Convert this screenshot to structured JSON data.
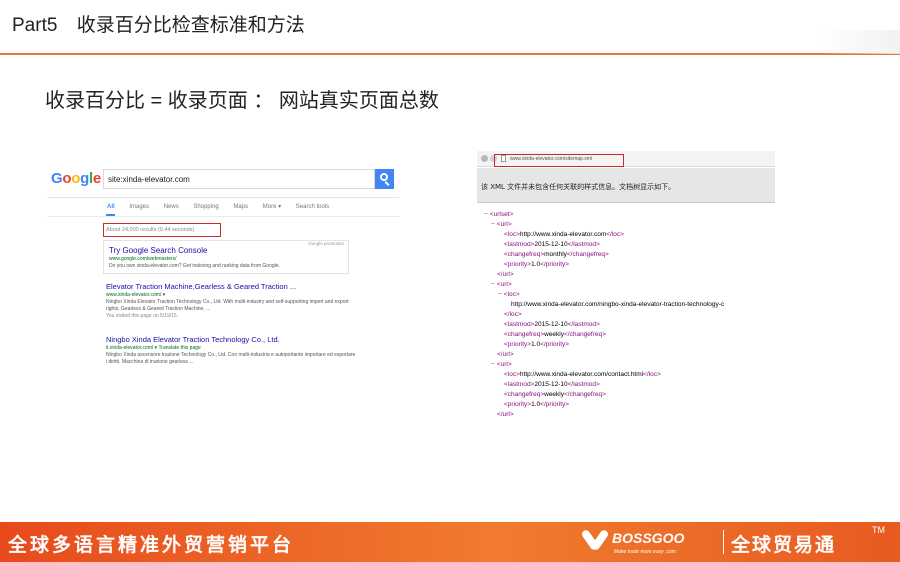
{
  "slide": {
    "part": "Part5",
    "title": "收录百分比检查标准和方法",
    "formula": "收录百分比 =  收录页面 ： 网站真实页面总数"
  },
  "accent_color": "#e8743b",
  "google": {
    "logo": [
      "G",
      "o",
      "o",
      "g",
      "l",
      "e"
    ],
    "search_value": "site:xinda-elevator.com",
    "tabs": [
      "All",
      "Images",
      "News",
      "Shopping",
      "Maps",
      "More ▾",
      "Search tools"
    ],
    "active_tab": "All",
    "stats": "About 24,000 results (0.44 seconds)",
    "promo": {
      "tag": "Google promotion",
      "title": "Try Google Search Console",
      "url": "www.google.com/webmasters/",
      "desc": "Do you own xinda-elevator.com? Get indexing and ranking data from Google."
    },
    "results": [
      {
        "title": "Elevator Traction Machine,Gearless & Geared Traction ...",
        "url": "www.xinda-elevator.com/ ▾",
        "desc": "Ningbo Xinda Elevator Traction Technology Co., Ltd. With multi-industry and self-supporting import and export rights, Gearless & Geared Traction Machine, ...",
        "visited": "You visited this page on 5/19/15."
      },
      {
        "title": "Ningbo Xinda Elevator Traction Technology Co., Ltd.",
        "url": "it.xinda-elevator.com/ ▾  Translate this page",
        "desc": "Ningbo Xinda ascensore trazione Technology Co., Ltd. Con multi-industria e autoportante importare ed esportare i diritti. Macchina di trazione gearless ...",
        "visited": ""
      }
    ]
  },
  "xml": {
    "address": "www.xinda-elevator.com/sitemap.xml",
    "info": "该 XML 文件并未包含任何关联的样式信息。文档树显示如下。",
    "lines": [
      {
        "minus": "−",
        "text": "",
        "open": "<urlset>",
        "close": ""
      },
      {
        "minus": "−",
        "text": "",
        "open": "<url>",
        "close": ""
      },
      {
        "minus": "",
        "text": "http://www.xinda-elevator.com",
        "open": "<loc>",
        "close": "</loc>"
      },
      {
        "minus": "",
        "text": "2015-12-10",
        "open": "<lastmod>",
        "close": "</lastmod>"
      },
      {
        "minus": "",
        "text": "monthly",
        "open": "<changefreq>",
        "close": "</changefreq>"
      },
      {
        "minus": "",
        "text": "1.0",
        "open": "<priority>",
        "close": "</priority>"
      },
      {
        "minus": "",
        "text": "",
        "open": "</url>",
        "close": ""
      },
      {
        "minus": "−",
        "text": "",
        "open": "<url>",
        "close": ""
      },
      {
        "minus": "−",
        "text": "",
        "open": "<loc>",
        "close": ""
      },
      {
        "minus": "",
        "text": "http://www.xinda-elevator.com/ningbo-xinda-elevator-traction-technology-c",
        "open": "",
        "close": ""
      },
      {
        "minus": "",
        "text": "",
        "open": "</loc>",
        "close": ""
      },
      {
        "minus": "",
        "text": "2015-12-10",
        "open": "<lastmod>",
        "close": "</lastmod>"
      },
      {
        "minus": "",
        "text": "weekly",
        "open": "<changefreq>",
        "close": "</changefreq>"
      },
      {
        "minus": "",
        "text": "1.0",
        "open": "<priority>",
        "close": "</priority>"
      },
      {
        "minus": "",
        "text": "",
        "open": "</url>",
        "close": ""
      },
      {
        "minus": "−",
        "text": "",
        "open": "<url>",
        "close": ""
      },
      {
        "minus": "",
        "text": "http://www.xinda-elevator.com/contact.html",
        "open": "<loc>",
        "close": "</loc>"
      },
      {
        "minus": "",
        "text": "2015-12-10",
        "open": "<lastmod>",
        "close": "</lastmod>"
      },
      {
        "minus": "",
        "text": "weekly",
        "open": "<changefreq>",
        "close": "</changefreq>"
      },
      {
        "minus": "",
        "text": "1.0",
        "open": "<priority>",
        "close": "</priority>"
      },
      {
        "minus": "",
        "text": "",
        "open": "</url>",
        "close": ""
      }
    ]
  },
  "footer": {
    "slogan": "全球多语言精准外贸营销平台",
    "brand": "BOSSGOO",
    "brand_sub": "Make trade more easy  .com",
    "brand_cn": "全球贸易通",
    "tm": "TM"
  }
}
